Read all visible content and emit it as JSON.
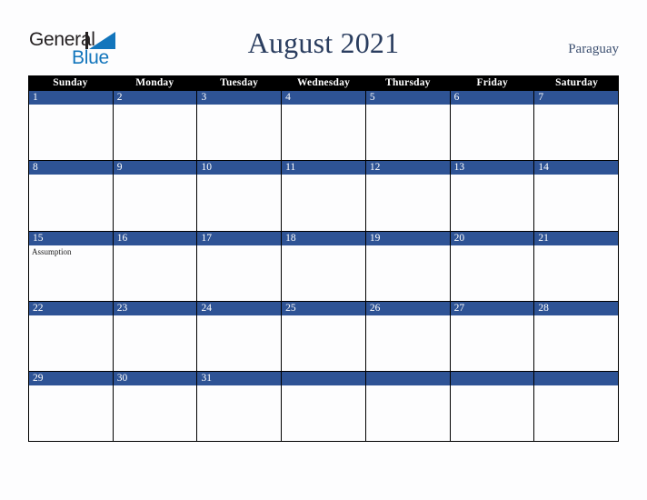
{
  "brand": {
    "name_part1": "General",
    "name_part2": "Blue",
    "triangle_color": "#1275bc",
    "text_color": "#231f20"
  },
  "header": {
    "title": "August 2021",
    "country": "Paraguay",
    "title_color": "#2a3d5f"
  },
  "calendar": {
    "month": "August",
    "year": "2021",
    "weekday_headers": [
      "Sunday",
      "Monday",
      "Tuesday",
      "Wednesday",
      "Thursday",
      "Friday",
      "Saturday"
    ],
    "header_bg": "#000000",
    "day_bar_bg": "#2e5395",
    "grid_border": "#000000",
    "cell_bg": "#fdfdfe",
    "weeks": [
      [
        {
          "day": "1",
          "events": []
        },
        {
          "day": "2",
          "events": []
        },
        {
          "day": "3",
          "events": []
        },
        {
          "day": "4",
          "events": []
        },
        {
          "day": "5",
          "events": []
        },
        {
          "day": "6",
          "events": []
        },
        {
          "day": "7",
          "events": []
        }
      ],
      [
        {
          "day": "8",
          "events": []
        },
        {
          "day": "9",
          "events": []
        },
        {
          "day": "10",
          "events": []
        },
        {
          "day": "11",
          "events": []
        },
        {
          "day": "12",
          "events": []
        },
        {
          "day": "13",
          "events": []
        },
        {
          "day": "14",
          "events": []
        }
      ],
      [
        {
          "day": "15",
          "events": [
            "Assumption"
          ]
        },
        {
          "day": "16",
          "events": []
        },
        {
          "day": "17",
          "events": []
        },
        {
          "day": "18",
          "events": []
        },
        {
          "day": "19",
          "events": []
        },
        {
          "day": "20",
          "events": []
        },
        {
          "day": "21",
          "events": []
        }
      ],
      [
        {
          "day": "22",
          "events": []
        },
        {
          "day": "23",
          "events": []
        },
        {
          "day": "24",
          "events": []
        },
        {
          "day": "25",
          "events": []
        },
        {
          "day": "26",
          "events": []
        },
        {
          "day": "27",
          "events": []
        },
        {
          "day": "28",
          "events": []
        }
      ],
      [
        {
          "day": "29",
          "events": []
        },
        {
          "day": "30",
          "events": []
        },
        {
          "day": "31",
          "events": []
        },
        {
          "day": "",
          "events": []
        },
        {
          "day": "",
          "events": []
        },
        {
          "day": "",
          "events": []
        },
        {
          "day": "",
          "events": []
        }
      ]
    ]
  }
}
